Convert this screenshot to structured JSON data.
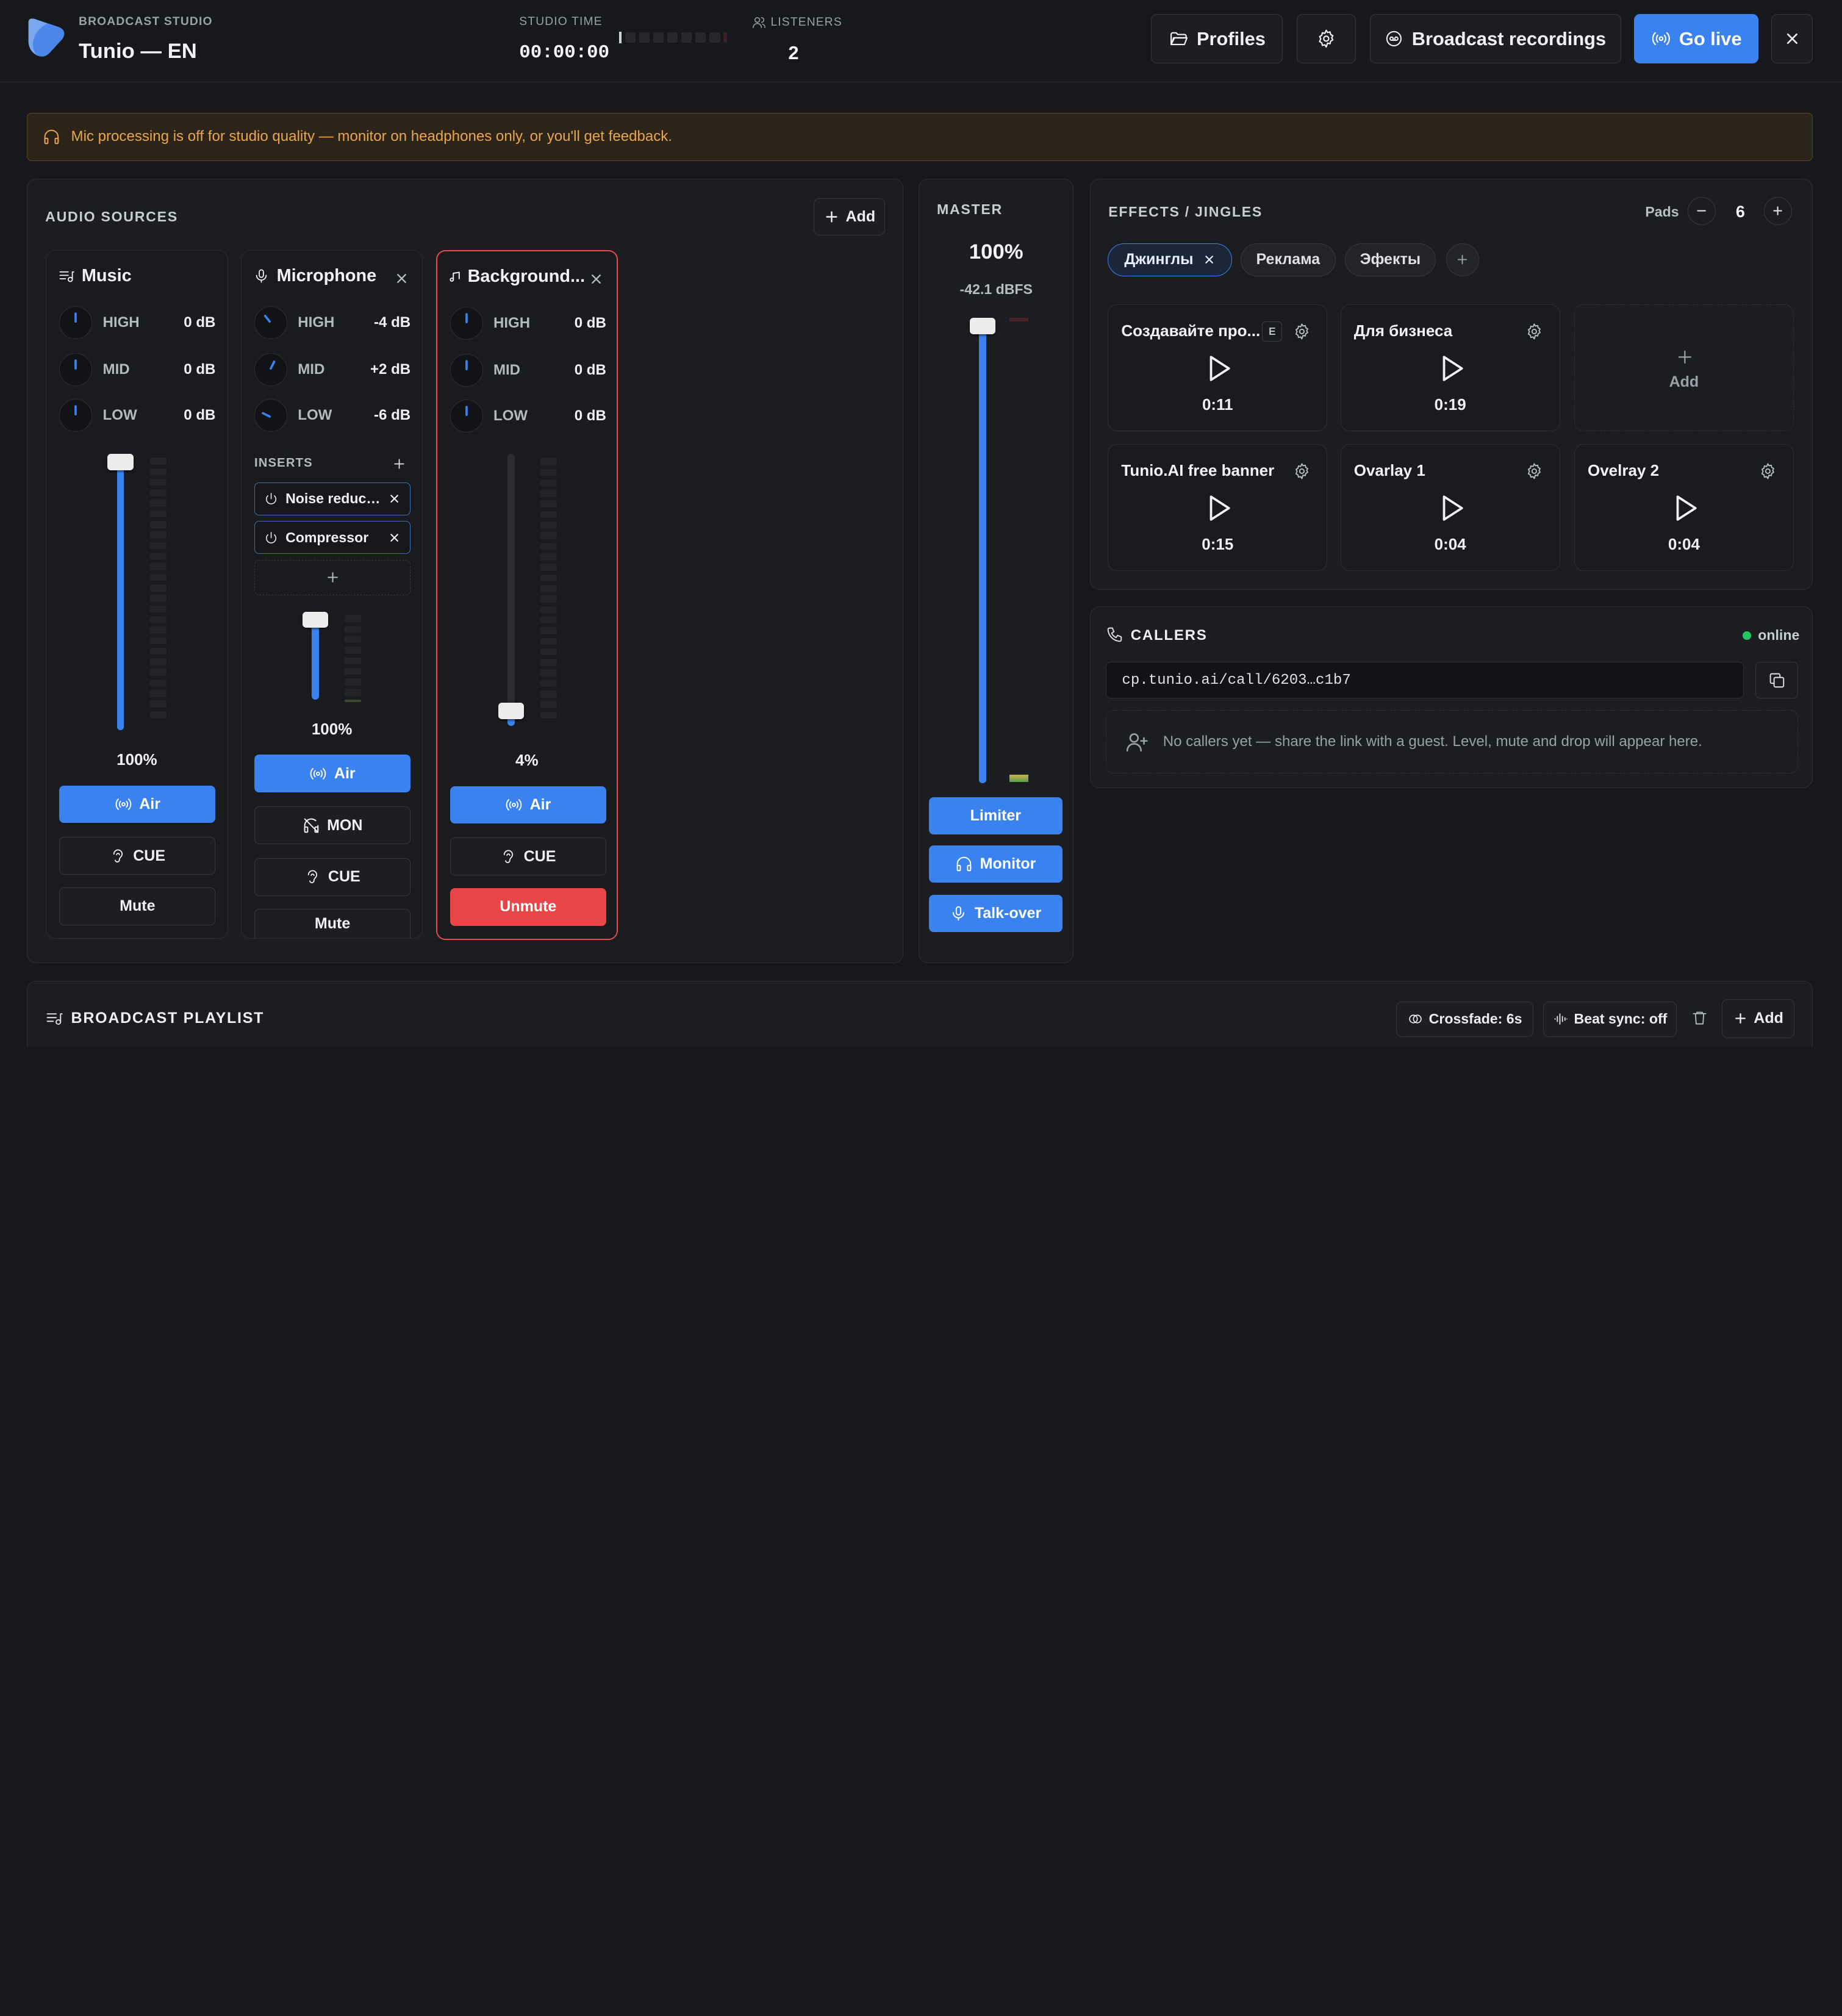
{
  "header": {
    "brand_sub": "BROADCAST STUDIO",
    "brand_title": "Tunio — EN",
    "studio_time_label": "STUDIO TIME",
    "studio_time": "00:00:00",
    "listeners_label": "LISTENERS",
    "listeners": "2",
    "profiles_label": "Profiles",
    "recordings_label": "Broadcast recordings",
    "golive_label": "Go live"
  },
  "notice": "Mic processing is off for studio quality — monitor on headphones only, or you'll get feedback.",
  "sources": {
    "title": "AUDIO SOURCES",
    "add_label": "Add",
    "channels": [
      {
        "name": "Music",
        "icon": "playlist-icon",
        "eq": [
          {
            "label": "HIGH",
            "value": "0 dB"
          },
          {
            "label": "MID",
            "value": "0 dB"
          },
          {
            "label": "LOW",
            "value": "0 dB"
          }
        ],
        "volume_pct": "100%",
        "air_label": "Air",
        "cue_label": "CUE",
        "mute_label": "Mute"
      },
      {
        "name": "Microphone",
        "icon": "mic-icon",
        "eq": [
          {
            "label": "HIGH",
            "value": "-4 dB"
          },
          {
            "label": "MID",
            "value": "+2 dB"
          },
          {
            "label": "LOW",
            "value": "-6 dB"
          }
        ],
        "inserts_label": "INSERTS",
        "inserts": [
          {
            "name": "Noise reduction"
          },
          {
            "name": "Compressor"
          }
        ],
        "volume_pct": "100%",
        "air_label": "Air",
        "mon_label": "MON",
        "cue_label": "CUE",
        "mute_label": "Mute"
      },
      {
        "name": "Background...",
        "icon": "music-note-icon",
        "eq": [
          {
            "label": "HIGH",
            "value": "0 dB"
          },
          {
            "label": "MID",
            "value": "0 dB"
          },
          {
            "label": "LOW",
            "value": "0 dB"
          }
        ],
        "volume_pct": "4%",
        "air_label": "Air",
        "cue_label": "CUE",
        "unmute_label": "Unmute"
      }
    ]
  },
  "master": {
    "title": "MASTER",
    "volume": "100%",
    "level": "-42.1 dBFS",
    "limiter_label": "Limiter",
    "monitor_label": "Monitor",
    "talkover_label": "Talk-over"
  },
  "effects": {
    "title": "EFFECTS / JINGLES",
    "pads_label": "Pads",
    "pads_count": "6",
    "tabs": [
      "Джинглы",
      "Реклама",
      "Эфекты"
    ],
    "pads": [
      {
        "name": "Создавайте про...",
        "duration": "0:11",
        "badge": "E"
      },
      {
        "name": "Для бизнеса",
        "duration": "0:19"
      },
      {
        "name": "Tunio.AI free banner",
        "duration": "0:15"
      },
      {
        "name": "Ovarlay 1",
        "duration": "0:04"
      },
      {
        "name": "Ovelray 2",
        "duration": "0:04"
      }
    ],
    "add_pad_label": "Add"
  },
  "callers": {
    "title": "CALLERS",
    "status": "online",
    "link": "cp.tunio.ai/call/6203…c1b7",
    "empty": "No callers yet — share the link with a guest. Level, mute and drop will appear here."
  },
  "playlist": {
    "title": "BROADCAST PLAYLIST",
    "crossfade": "Crossfade: 6s",
    "beatsync": "Beat sync: off",
    "add_label": "Add"
  },
  "colors": {
    "accent": "#3a82f0",
    "danger": "#e84546",
    "warning": "#e9a64a",
    "online": "#22c55e"
  }
}
